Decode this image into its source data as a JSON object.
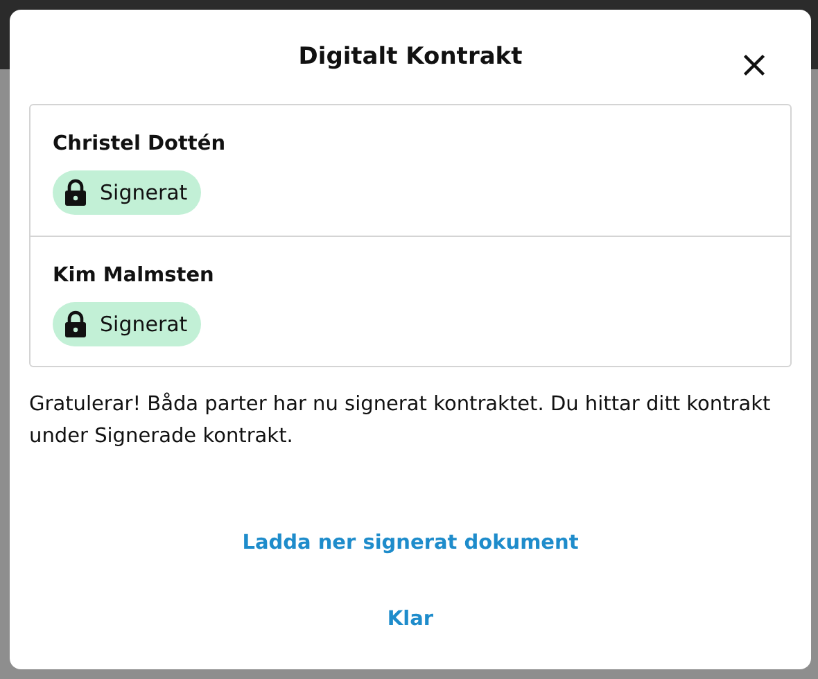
{
  "dialog": {
    "title": "Digitalt Kontrakt"
  },
  "signers": [
    {
      "name": "Christel Dottén",
      "status": "Signerat"
    },
    {
      "name": "Kim Malmsten",
      "status": "Signerat"
    }
  ],
  "message": "Gratulerar! Båda parter har nu signerat kontraktet. Du hittar ditt kontrakt under Signerade kontrakt.",
  "actions": [
    "Ladda ner signerat dokument",
    "Klar"
  ]
}
